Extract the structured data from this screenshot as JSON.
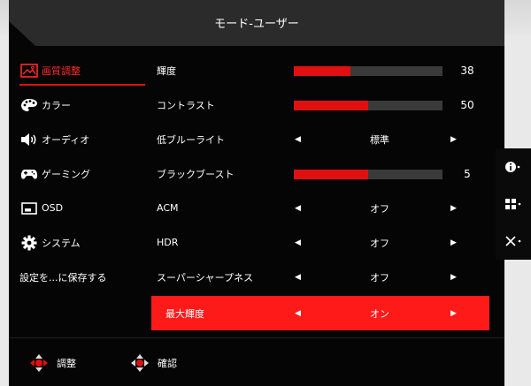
{
  "header": {
    "title": "モード-ユーザー"
  },
  "sidebar": {
    "items": [
      {
        "label": "画質調整",
        "icon": "picture-icon",
        "active": true
      },
      {
        "label": "カラー",
        "icon": "palette-icon",
        "active": false
      },
      {
        "label": "オーディオ",
        "icon": "speaker-icon",
        "active": false
      },
      {
        "label": "ゲーミング",
        "icon": "gamepad-icon",
        "active": false
      },
      {
        "label": "OSD",
        "icon": "osd-icon",
        "active": false
      },
      {
        "label": "システム",
        "icon": "gear-icon",
        "active": false
      }
    ],
    "save_label": "設定を...に保存する"
  },
  "settings": [
    {
      "label": "輝度",
      "type": "slider",
      "value": 38
    },
    {
      "label": "コントラスト",
      "type": "slider",
      "value": 50
    },
    {
      "label": "低ブルーライト",
      "type": "select",
      "value": "標準"
    },
    {
      "label": "ブラックブースト",
      "type": "slider",
      "value": 5,
      "fill_percent": 50
    },
    {
      "label": "ACM",
      "type": "select",
      "value": "オフ"
    },
    {
      "label": "HDR",
      "type": "select",
      "value": "オフ"
    },
    {
      "label": "スーパーシャープネス",
      "type": "select",
      "value": "オフ"
    },
    {
      "label": "最大輝度",
      "type": "select",
      "value": "オン",
      "selected": true
    }
  ],
  "footer": {
    "adjust_label": "調整",
    "confirm_label": "確認"
  },
  "colors": {
    "accent": "#e01010",
    "background": "#050505"
  },
  "right_panel": {
    "icons": [
      "info-icon",
      "input-icon",
      "close-icon"
    ]
  }
}
